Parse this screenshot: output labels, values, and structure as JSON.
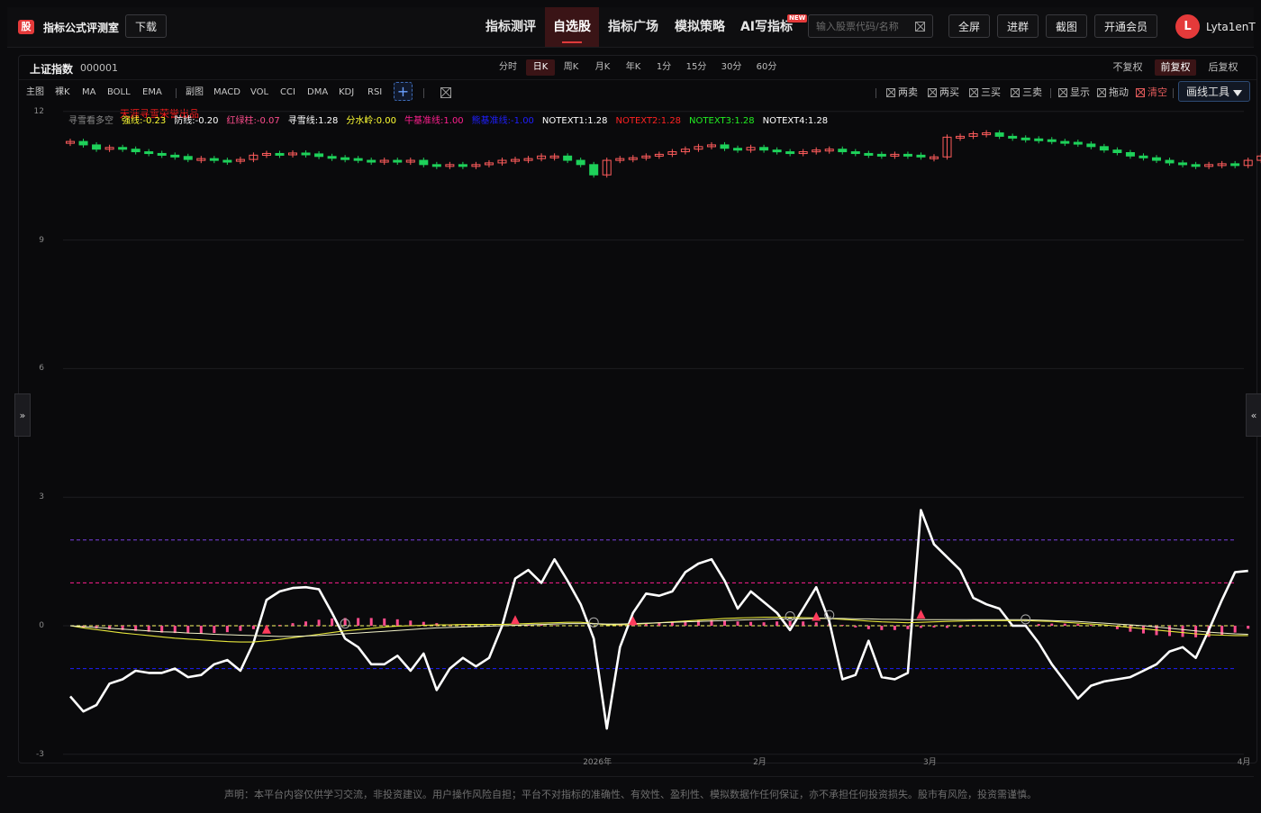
{
  "app": {
    "logo_char": "股",
    "title": "指标公式评测室",
    "download_label": "下载"
  },
  "nav": [
    {
      "label": "指标测评",
      "active": false
    },
    {
      "label": "自选股",
      "active": true
    },
    {
      "label": "指标广场",
      "active": false
    },
    {
      "label": "模拟策略",
      "active": false
    },
    {
      "label": "AI写指标",
      "active": false,
      "badge": "NEW"
    }
  ],
  "search": {
    "placeholder": "输入股票代码/名称",
    "value": ""
  },
  "header_buttons": {
    "fullscreen": "全屏",
    "join_group": "进群",
    "screenshot": "截图",
    "membership": "开通会员"
  },
  "user": {
    "avatar_letter": "L",
    "name": "Lyta1enT"
  },
  "instrument": {
    "name": "上证指数",
    "code": "000001"
  },
  "periods": [
    {
      "label": "分时",
      "active": false
    },
    {
      "label": "日K",
      "active": true
    },
    {
      "label": "周K",
      "active": false
    },
    {
      "label": "月K",
      "active": false
    },
    {
      "label": "年K",
      "active": false
    },
    {
      "label": "1分",
      "active": false
    },
    {
      "label": "15分",
      "active": false
    },
    {
      "label": "30分",
      "active": false
    },
    {
      "label": "60分",
      "active": false
    }
  ],
  "adjust": [
    {
      "label": "不复权",
      "active": false
    },
    {
      "label": "前复权",
      "active": true
    },
    {
      "label": "后复权",
      "active": false
    }
  ],
  "toolbar": {
    "main_label": "主图",
    "main_items": [
      "裸K",
      "MA",
      "BOLL",
      "EMA"
    ],
    "sub_label": "副图",
    "sub_items": [
      "MACD",
      "VOL",
      "CCI",
      "DMA",
      "KDJ",
      "RSI"
    ],
    "add_label": "+",
    "right_checks": [
      {
        "label": "两卖",
        "color": "#c8c8c8"
      },
      {
        "label": "两买",
        "color": "#c8c8c8"
      },
      {
        "label": "三买",
        "color": "#c8c8c8"
      },
      {
        "label": "三卖",
        "color": "#c8c8c8"
      },
      {
        "label": "显示",
        "color": "#c8c8c8"
      },
      {
        "label": "拖动",
        "color": "#c8c8c8"
      },
      {
        "label": "清空",
        "color": "#e05a5a"
      }
    ],
    "draw_tools_label": "画线工具"
  },
  "indicator_legend": {
    "credit": "天涯寻雪荣誉出品",
    "items": [
      {
        "text": "寻雪看多空",
        "color": "#8a8a8a"
      },
      {
        "text": "强线:-0.23",
        "color": "#ffff33"
      },
      {
        "text": "防线:-0.20",
        "color": "#ffffff"
      },
      {
        "text": "红绿柱:-0.07",
        "color": "#ff4d8d"
      },
      {
        "text": "寻雪线:1.28",
        "color": "#ffffff"
      },
      {
        "text": "分水岭:0.00",
        "color": "#ffff33"
      },
      {
        "text": "牛基准线:1.00",
        "color": "#ff1f8f"
      },
      {
        "text": "熊基准线:-1.00",
        "color": "#1f1fff"
      },
      {
        "text": "NOTEXT1:1.28",
        "color": "#ffffff"
      },
      {
        "text": "NOTEXT2:1.28",
        "color": "#ff2222"
      },
      {
        "text": "NOTEXT3:1.28",
        "color": "#22ee22"
      },
      {
        "text": "NOTEXT4:1.28",
        "color": "#ffffff"
      }
    ]
  },
  "chart_data": {
    "type": "line",
    "ylim": [
      -3,
      12
    ],
    "yticks": [
      12,
      9,
      6,
      3,
      0,
      -3
    ],
    "x_labels": [
      {
        "label": "2026年",
        "index": 40
      },
      {
        "label": "2月",
        "index": 53
      },
      {
        "label": "3月",
        "index": 66
      },
      {
        "label": "4月",
        "index": 90
      }
    ],
    "reference_lines": [
      {
        "name": "bull-baseline",
        "value": 2.0,
        "color": "#7b3fe4"
      },
      {
        "name": "bull-line",
        "value": 1.0,
        "color": "#ff1f8f"
      },
      {
        "name": "watershed",
        "value": 0.0,
        "color": "#ffff66"
      },
      {
        "name": "bear-line",
        "value": -1.0,
        "color": "#1f1fff"
      }
    ],
    "candles": {
      "up_color": "#ff5c5c",
      "down_color": "#1ed15a",
      "closes": [
        11.3,
        11.22,
        11.12,
        11.16,
        11.12,
        11.06,
        11.02,
        10.98,
        10.95,
        10.88,
        10.9,
        10.86,
        10.85,
        10.88,
        10.98,
        11.02,
        11.0,
        11.03,
        11.01,
        10.95,
        10.92,
        10.9,
        10.86,
        10.84,
        10.86,
        10.84,
        10.86,
        10.76,
        10.74,
        10.76,
        10.74,
        10.76,
        10.8,
        10.86,
        10.88,
        10.9,
        10.96,
        10.96,
        10.86,
        10.76,
        10.52,
        10.86,
        10.9,
        10.92,
        10.96,
        11.0,
        11.06,
        11.12,
        11.18,
        11.22,
        11.14,
        11.1,
        11.16,
        11.1,
        11.06,
        11.02,
        11.06,
        11.1,
        11.12,
        11.06,
        11.02,
        11.0,
        10.98,
        11.0,
        10.98,
        10.94,
        10.94,
        11.4,
        11.42,
        11.48,
        11.5,
        11.42,
        11.38,
        11.36,
        11.34,
        11.3,
        11.28,
        11.24,
        11.18,
        11.1,
        11.04,
        10.96,
        10.92,
        10.86,
        10.8,
        10.76,
        10.74,
        10.76,
        10.78,
        10.74,
        10.86,
        10.96,
        10.98,
        10.98
      ]
    },
    "series": [
      {
        "name": "寻雪线",
        "color": "#ffffff",
        "width": 2.6,
        "values": [
          -1.65,
          -2.0,
          -1.85,
          -1.35,
          -1.25,
          -1.05,
          -1.1,
          -1.1,
          -1.0,
          -1.2,
          -1.15,
          -0.9,
          -0.8,
          -1.05,
          -0.4,
          0.6,
          0.8,
          0.88,
          0.9,
          0.85,
          0.3,
          -0.3,
          -0.5,
          -0.9,
          -0.9,
          -0.7,
          -1.05,
          -0.65,
          -1.5,
          -1.0,
          -0.75,
          -0.95,
          -0.75,
          0.0,
          1.1,
          1.3,
          1.0,
          1.55,
          1.05,
          0.5,
          -0.3,
          -2.4,
          -0.5,
          0.3,
          0.75,
          0.7,
          0.8,
          1.25,
          1.45,
          1.55,
          1.05,
          0.4,
          0.8,
          0.55,
          0.3,
          -0.1,
          0.4,
          0.9,
          0.1,
          -1.25,
          -1.15,
          -0.35,
          -1.2,
          -1.25,
          -1.1,
          2.7,
          1.9,
          1.6,
          1.3,
          0.65,
          0.5,
          0.4,
          0.0,
          0.0,
          -0.4,
          -0.9,
          -1.3,
          -1.7,
          -1.4,
          -1.3,
          -1.25,
          -1.2,
          -1.05,
          -0.9,
          -0.6,
          -0.5,
          -0.75,
          -0.1,
          0.6,
          1.25,
          1.28
        ]
      },
      {
        "name": "强线",
        "color": "#e6e63c",
        "width": 1.1,
        "values": [
          0.0,
          -0.05,
          -0.09,
          -0.13,
          -0.17,
          -0.2,
          -0.23,
          -0.26,
          -0.29,
          -0.31,
          -0.33,
          -0.35,
          -0.37,
          -0.38,
          -0.38,
          -0.35,
          -0.32,
          -0.28,
          -0.24,
          -0.2,
          -0.16,
          -0.12,
          -0.09,
          -0.06,
          -0.03,
          -0.01,
          0.0,
          0.01,
          0.02,
          0.02,
          0.03,
          0.03,
          0.03,
          0.03,
          0.04,
          0.05,
          0.06,
          0.07,
          0.08,
          0.08,
          0.05,
          0.02,
          0.02,
          0.03,
          0.05,
          0.07,
          0.09,
          0.11,
          0.13,
          0.15,
          0.17,
          0.18,
          0.19,
          0.2,
          0.2,
          0.2,
          0.19,
          0.18,
          0.17,
          0.15,
          0.13,
          0.11,
          0.09,
          0.08,
          0.07,
          0.08,
          0.09,
          0.1,
          0.11,
          0.12,
          0.12,
          0.12,
          0.12,
          0.12,
          0.11,
          0.1,
          0.08,
          0.06,
          0.04,
          0.02,
          -0.01,
          -0.04,
          -0.07,
          -0.1,
          -0.13,
          -0.16,
          -0.19,
          -0.21,
          -0.22,
          -0.23,
          -0.23
        ]
      },
      {
        "name": "防线",
        "color": "#f2f2c8",
        "width": 1.0,
        "values": [
          0.0,
          -0.02,
          -0.04,
          -0.06,
          -0.08,
          -0.1,
          -0.12,
          -0.14,
          -0.15,
          -0.17,
          -0.18,
          -0.2,
          -0.21,
          -0.22,
          -0.23,
          -0.24,
          -0.25,
          -0.25,
          -0.24,
          -0.23,
          -0.21,
          -0.19,
          -0.17,
          -0.15,
          -0.13,
          -0.11,
          -0.09,
          -0.07,
          -0.05,
          -0.04,
          -0.03,
          -0.02,
          -0.01,
          0.0,
          0.01,
          0.02,
          0.03,
          0.04,
          0.05,
          0.05,
          0.05,
          0.04,
          0.04,
          0.05,
          0.06,
          0.07,
          0.08,
          0.09,
          0.1,
          0.11,
          0.12,
          0.13,
          0.14,
          0.15,
          0.16,
          0.16,
          0.16,
          0.17,
          0.17,
          0.17,
          0.16,
          0.16,
          0.15,
          0.15,
          0.14,
          0.14,
          0.14,
          0.14,
          0.14,
          0.14,
          0.14,
          0.14,
          0.14,
          0.14,
          0.13,
          0.12,
          0.11,
          0.1,
          0.08,
          0.06,
          0.04,
          0.02,
          0.0,
          -0.03,
          -0.06,
          -0.09,
          -0.12,
          -0.15,
          -0.17,
          -0.19,
          -0.2
        ]
      }
    ],
    "histogram": {
      "name": "红绿柱",
      "color": "#ff4d8d",
      "values": [
        0,
        -0.04,
        -0.06,
        -0.08,
        -0.1,
        -0.12,
        -0.14,
        -0.16,
        -0.17,
        -0.18,
        -0.18,
        -0.17,
        -0.15,
        -0.12,
        -0.08,
        -0.04,
        0.02,
        0.06,
        0.1,
        0.14,
        0.17,
        0.18,
        0.18,
        0.18,
        0.17,
        0.15,
        0.12,
        0.09,
        0.06,
        0.03,
        0.01,
        0,
        0,
        0,
        0.01,
        0.02,
        0.02,
        0.01,
        0,
        0,
        0,
        0,
        0.02,
        0.04,
        0.06,
        0.08,
        0.1,
        0.12,
        0.13,
        0.13,
        0.12,
        0.1,
        0.09,
        0.08,
        0.1,
        0.12,
        0.1,
        0.08,
        0.05,
        0.02,
        -0.04,
        -0.08,
        -0.1,
        -0.1,
        -0.08,
        -0.05,
        -0.04,
        -0.05,
        -0.04,
        -0.02,
        0,
        0,
        0,
        0.02,
        0.04,
        0.05,
        0.05,
        0.04,
        0.02,
        0,
        -0.08,
        -0.14,
        -0.18,
        -0.22,
        -0.24,
        -0.26,
        -0.27,
        -0.26,
        -0.22,
        -0.16,
        -0.07
      ]
    },
    "markers": [
      {
        "type": "triangle-up",
        "index": 15,
        "value": -0.1,
        "color": "#ff3b5c"
      },
      {
        "type": "triangle-up",
        "index": 34,
        "value": 0.12,
        "color": "#ff3b5c"
      },
      {
        "type": "triangle-up",
        "index": 43,
        "value": 0.1,
        "color": "#ff3b5c"
      },
      {
        "type": "triangle-up",
        "index": 57,
        "value": 0.2,
        "color": "#ff3b5c"
      },
      {
        "type": "triangle-up",
        "index": 65,
        "value": 0.25,
        "color": "#ff3b5c"
      },
      {
        "type": "circle-face",
        "index": 21,
        "value": 0.05,
        "color": "#aaaaaa"
      },
      {
        "type": "circle-face",
        "index": 40,
        "value": 0.08,
        "color": "#aaaaaa"
      },
      {
        "type": "circle-face",
        "index": 55,
        "value": 0.22,
        "color": "#aaaaaa"
      },
      {
        "type": "circle-face",
        "index": 58,
        "value": 0.25,
        "color": "#aaaaaa"
      },
      {
        "type": "circle-face",
        "index": 73,
        "value": 0.15,
        "color": "#aaaaaa"
      }
    ]
  },
  "side_buttons": {
    "left": "»",
    "right": "«"
  },
  "footer": {
    "disclaimer": "声明：本平台内容仅供学习交流，非投资建议。用户操作风险自担；平台不对指标的准确性、有效性、盈利性、模拟数据作任何保证，亦不承担任何投资损失。股市有风险，投资需谨慎。"
  }
}
